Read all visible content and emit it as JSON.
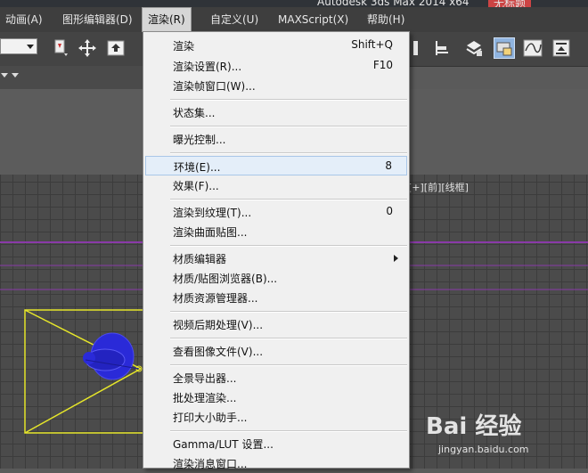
{
  "window": {
    "title": "Autodesk 3ds Max  2014 x64",
    "document": "无标题"
  },
  "menubar": [
    {
      "label": "动画(A)"
    },
    {
      "label": "图形编辑器(D)"
    },
    {
      "label": "渲染(R)",
      "active": true
    },
    {
      "label": "自定义(U)"
    },
    {
      "label": "MAXScript(X)"
    },
    {
      "label": "帮助(H)"
    }
  ],
  "viewport": {
    "label": "[+][前][线框]"
  },
  "render_menu": {
    "groups": [
      [
        {
          "label": "渲染",
          "shortcut": "Shift+Q"
        },
        {
          "label": "渲染设置(R)...",
          "shortcut": "F10"
        },
        {
          "label": "渲染帧窗口(W)..."
        }
      ],
      [
        {
          "label": "状态集..."
        }
      ],
      [
        {
          "label": "曝光控制..."
        }
      ],
      [
        {
          "label": "环境(E)...",
          "shortcut": "8",
          "highlighted": true
        },
        {
          "label": "效果(F)..."
        }
      ],
      [
        {
          "label": "渲染到纹理(T)...",
          "shortcut": "0"
        },
        {
          "label": "渲染曲面贴图..."
        }
      ],
      [
        {
          "label": "材质编辑器",
          "submenu": true
        },
        {
          "label": "材质/贴图浏览器(B)..."
        },
        {
          "label": "材质资源管理器..."
        }
      ],
      [
        {
          "label": "视频后期处理(V)..."
        }
      ],
      [
        {
          "label": "查看图像文件(V)..."
        }
      ],
      [
        {
          "label": "全景导出器..."
        },
        {
          "label": "批处理渲染..."
        },
        {
          "label": "打印大小助手..."
        }
      ],
      [
        {
          "label": "Gamma/LUT 设置..."
        },
        {
          "label": "渲染消息窗口..."
        }
      ]
    ]
  },
  "watermark": {
    "logo": "Bai 经验",
    "url": "jingyan.baidu.com"
  },
  "colors": {
    "menu_bg": "#f0f0f0",
    "highlight": "#e4eef9",
    "ui_dark": "#444444",
    "scene_blue": "#2a2ad8",
    "scene_yellow": "#e6e62a",
    "grid_purple": "#8a3aa8"
  }
}
